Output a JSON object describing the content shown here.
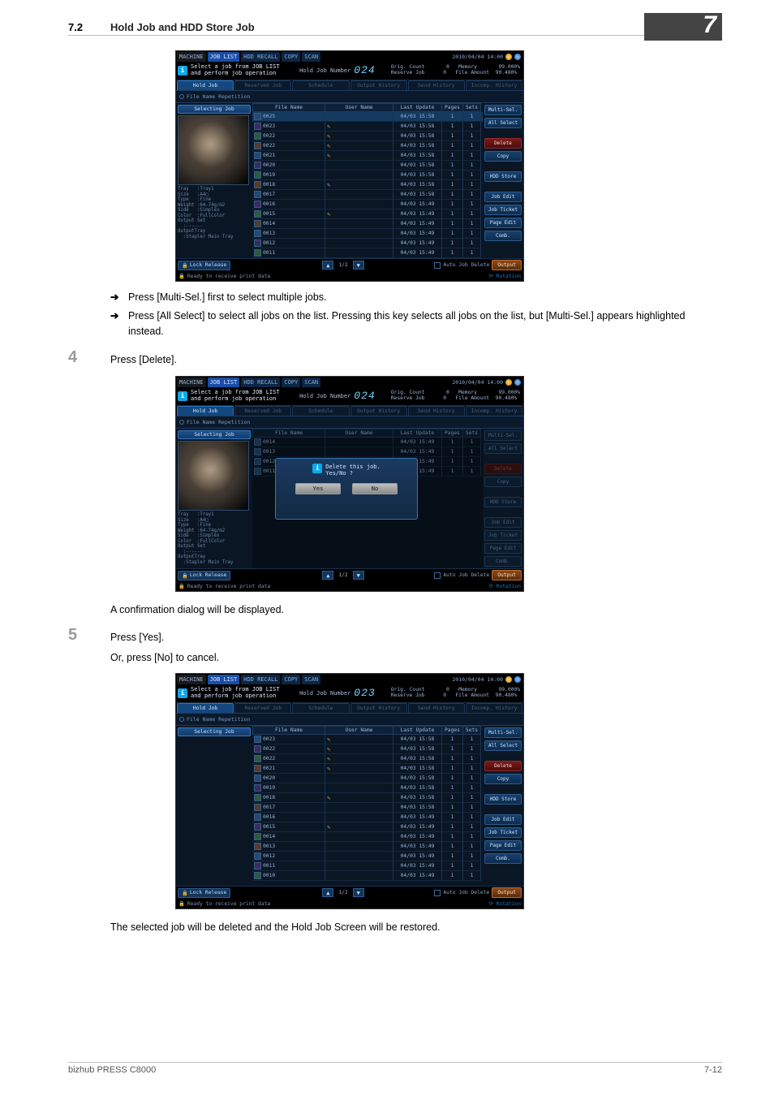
{
  "header": {
    "section_number": "7.2",
    "section_title": "Hold Job and HDD Store Job"
  },
  "chapter_number": "7",
  "bullet1": "Press [Multi-Sel.] first to select multiple jobs.",
  "bullet2": "Press [All Select] to select all jobs on the list. Pressing this key selects all jobs on the list, but [Multi-Sel.] appears highlighted instead.",
  "step4": {
    "num": "4",
    "text": "Press [Delete]."
  },
  "caption1": "A confirmation dialog will be displayed.",
  "step5": {
    "num": "5",
    "text": "Press [Yes].",
    "sub": "Or, press [No] to cancel."
  },
  "caption2": "The selected job will be deleted and the Hold Job Screen will be restored.",
  "footer": {
    "model": "bizhub PRESS C8000",
    "page": "7-12"
  },
  "instruction": "Select a job from JOB LIST\nand perform job operation",
  "hold_label": "Hold Job Number",
  "datetime": "2010/04/04 14:00",
  "tabs": {
    "machine": "MACHINE",
    "joblist": "JOB LIST",
    "recall": "HDD RECALL",
    "copy": "COPY",
    "scan": "SCAN"
  },
  "subtabs": {
    "hold": "Hold Job",
    "reserved": "Reserved Job",
    "schedule": "Schedule",
    "output_hist": "Output History",
    "send_hist": "Send History",
    "incomp_hist": "Incomp. History"
  },
  "file_repetition": "File Name Repetition",
  "selecting_job": "Selecting Job",
  "columns": {
    "file": "File Name",
    "user": "User Name",
    "updated": "Last Update",
    "pages": "Pages",
    "sets": "Sets"
  },
  "rightbtns": {
    "multi": "Multi-Sel.",
    "all": "All Select",
    "delete": "Delete",
    "copy": "Copy",
    "hdd": "HDD Store",
    "jobedit": "Job Edit",
    "jobticket": "Job Ticket",
    "pageedit": "Page Edit",
    "comb": "Comb."
  },
  "bottom": {
    "lock": "Lock Release",
    "auto": "Auto Job Delete",
    "output": "Output",
    "status": "Ready to receive print data",
    "rotation": "Rotation"
  },
  "pager_1_2": "1/2",
  "shot1": {
    "hold_num": "024",
    "rightstats": "Orig. Count       0   Memory       99.000%\nReserve Job      0   File Amount  90.480%",
    "metadata": "Tray   :Tray1\nSize   :A4□\nType   :Fine\nWeight :64-74g/m2\nSide   :Simplex\nColor  :FullColor\nOutput Set\n  :------\nOutputTray\n  :Stapler Main Tray",
    "rows": [
      {
        "f": "0025",
        "u": "",
        "d": "04/03 15:58",
        "p": "1",
        "s": "1",
        "sel": true,
        "pin": false,
        "ic": "a"
      },
      {
        "f": "0023",
        "u": "",
        "d": "04/03 15:58",
        "p": "1",
        "s": "1",
        "sel": false,
        "pin": true,
        "ic": "b"
      },
      {
        "f": "0022",
        "u": "",
        "d": "04/03 15:58",
        "p": "1",
        "s": "1",
        "sel": false,
        "pin": true,
        "ic": "c"
      },
      {
        "f": "0022",
        "u": "",
        "d": "04/03 15:58",
        "p": "1",
        "s": "1",
        "sel": false,
        "pin": true,
        "ic": "d"
      },
      {
        "f": "0021",
        "u": "",
        "d": "04/03 15:58",
        "p": "1",
        "s": "1",
        "sel": false,
        "pin": true,
        "ic": "a"
      },
      {
        "f": "0020",
        "u": "",
        "d": "04/03 15:58",
        "p": "1",
        "s": "1",
        "sel": false,
        "pin": false,
        "ic": "b"
      },
      {
        "f": "0019",
        "u": "",
        "d": "04/03 15:58",
        "p": "1",
        "s": "1",
        "sel": false,
        "pin": false,
        "ic": "c"
      },
      {
        "f": "0018",
        "u": "",
        "d": "04/03 15:58",
        "p": "1",
        "s": "1",
        "sel": false,
        "pin": true,
        "ic": "d"
      },
      {
        "f": "0017",
        "u": "",
        "d": "04/03 15:58",
        "p": "1",
        "s": "1",
        "sel": false,
        "pin": false,
        "ic": "a"
      },
      {
        "f": "0016",
        "u": "",
        "d": "04/03 15:49",
        "p": "1",
        "s": "1",
        "sel": false,
        "pin": false,
        "ic": "b"
      },
      {
        "f": "0015",
        "u": "",
        "d": "04/03 15:49",
        "p": "1",
        "s": "1",
        "sel": false,
        "pin": true,
        "ic": "c"
      },
      {
        "f": "0014",
        "u": "",
        "d": "04/03 15:49",
        "p": "1",
        "s": "1",
        "sel": false,
        "pin": false,
        "ic": "d"
      },
      {
        "f": "0013",
        "u": "",
        "d": "04/03 15:49",
        "p": "1",
        "s": "1",
        "sel": false,
        "pin": false,
        "ic": "a"
      },
      {
        "f": "0012",
        "u": "",
        "d": "04/03 15:49",
        "p": "1",
        "s": "1",
        "sel": false,
        "pin": false,
        "ic": "b"
      },
      {
        "f": "0011",
        "u": "",
        "d": "04/03 15:49",
        "p": "1",
        "s": "1",
        "sel": false,
        "pin": false,
        "ic": "c"
      }
    ]
  },
  "shot2": {
    "hold_num": "024",
    "confirm_msg": "Delete this job.\nYes/No ?",
    "yes": "Yes",
    "no": "No",
    "metadata": "Tray   :Tray1\nSize   :A4□\nType   :Fine\nWeight :64-74g/m2\nSide   :Simplex\nColor  :FullColor\nOutput Set\n  :------\nOutputTray\n  :Stapler Main Tray",
    "rows": [
      {
        "f": "0014",
        "u": "",
        "d": "04/03 15:49",
        "p": "1",
        "s": "1"
      },
      {
        "f": "0013",
        "u": "",
        "d": "04/03 15:49",
        "p": "1",
        "s": "1"
      },
      {
        "f": "0012",
        "u": "",
        "d": "04/03 15:49",
        "p": "1",
        "s": "1"
      },
      {
        "f": "0011",
        "u": "",
        "d": "04/03 15:49",
        "p": "1",
        "s": "1"
      }
    ]
  },
  "shot3": {
    "hold_num": "023",
    "rows": [
      {
        "f": "0023",
        "u": "",
        "d": "04/03 15:58",
        "p": "1",
        "s": "1",
        "pin": true,
        "ic": "a"
      },
      {
        "f": "0022",
        "u": "",
        "d": "04/03 15:58",
        "p": "1",
        "s": "1",
        "pin": true,
        "ic": "b"
      },
      {
        "f": "0022",
        "u": "",
        "d": "04/03 15:58",
        "p": "1",
        "s": "1",
        "pin": true,
        "ic": "c"
      },
      {
        "f": "0021",
        "u": "",
        "d": "04/03 15:58",
        "p": "1",
        "s": "1",
        "pin": true,
        "ic": "d"
      },
      {
        "f": "0020",
        "u": "",
        "d": "04/03 15:58",
        "p": "1",
        "s": "1",
        "pin": false,
        "ic": "a"
      },
      {
        "f": "0019",
        "u": "",
        "d": "04/03 15:58",
        "p": "1",
        "s": "1",
        "pin": false,
        "ic": "b"
      },
      {
        "f": "0018",
        "u": "",
        "d": "04/03 15:58",
        "p": "1",
        "s": "1",
        "pin": true,
        "ic": "c"
      },
      {
        "f": "0017",
        "u": "",
        "d": "04/03 15:58",
        "p": "1",
        "s": "1",
        "pin": false,
        "ic": "d"
      },
      {
        "f": "0016",
        "u": "",
        "d": "04/03 15:49",
        "p": "1",
        "s": "1",
        "pin": false,
        "ic": "a"
      },
      {
        "f": "0015",
        "u": "",
        "d": "04/03 15:49",
        "p": "1",
        "s": "1",
        "pin": true,
        "ic": "b"
      },
      {
        "f": "0014",
        "u": "",
        "d": "04/03 15:49",
        "p": "1",
        "s": "1",
        "pin": false,
        "ic": "c"
      },
      {
        "f": "0013",
        "u": "",
        "d": "04/03 15:49",
        "p": "1",
        "s": "1",
        "pin": false,
        "ic": "d"
      },
      {
        "f": "0012",
        "u": "",
        "d": "04/03 15:49",
        "p": "1",
        "s": "1",
        "pin": false,
        "ic": "a"
      },
      {
        "f": "0011",
        "u": "",
        "d": "04/03 15:49",
        "p": "1",
        "s": "1",
        "pin": false,
        "ic": "b"
      },
      {
        "f": "0010",
        "u": "",
        "d": "04/03 15:49",
        "p": "1",
        "s": "1",
        "pin": false,
        "ic": "c"
      }
    ]
  }
}
